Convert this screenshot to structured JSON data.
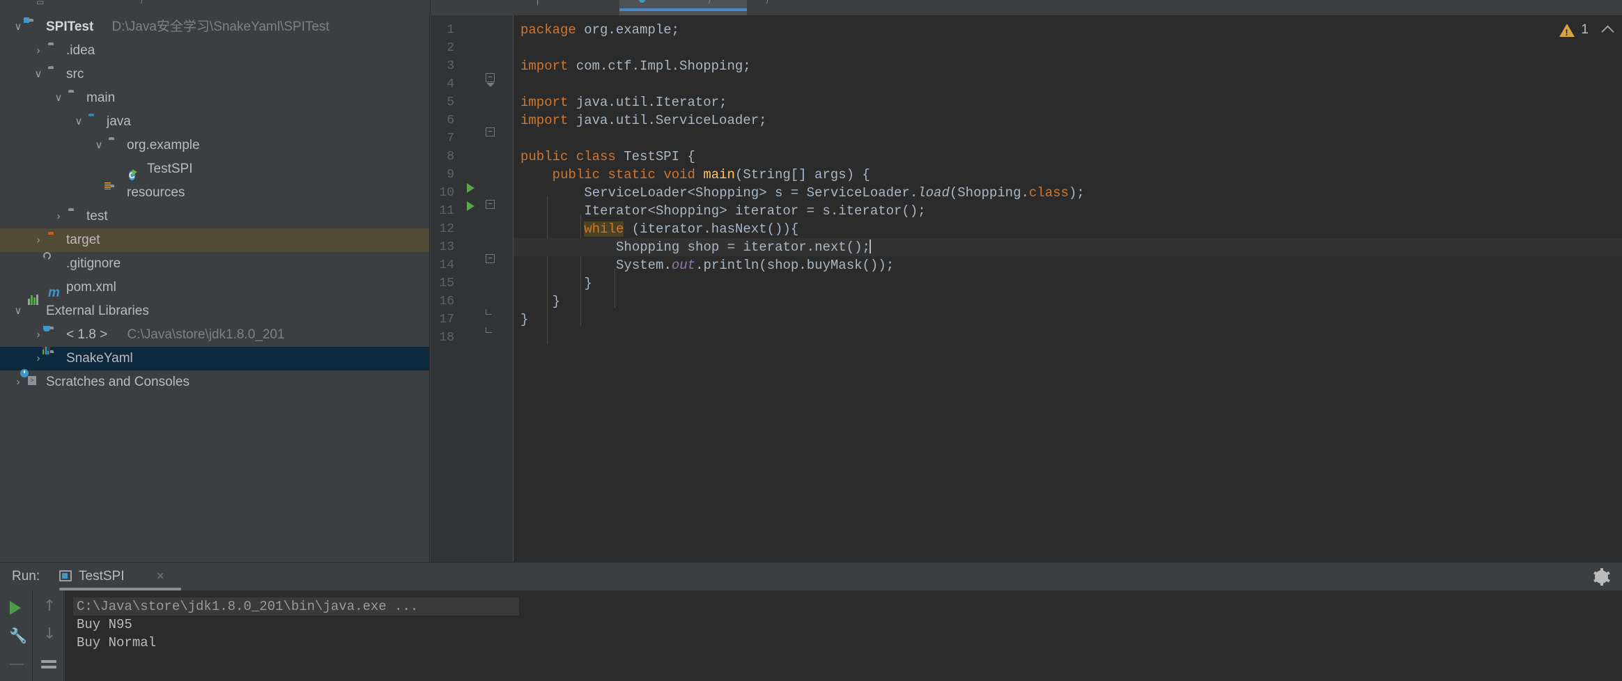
{
  "app": {
    "theme": "darcula",
    "accent": "#4a88c7",
    "warning_color": "#d9a343",
    "selection_blue": "#0d293e",
    "selection_amber": "#514b36"
  },
  "tab_bar": {
    "selected_tab_label": "",
    "selected_tab_icon": "java-class-icon"
  },
  "project_tree": {
    "items": [
      {
        "label": "SPITest",
        "sublabel": "D:\\Java安全学习\\SnakeYaml\\SPITest",
        "icon": "module-folder-icon",
        "twisty": "chevron-down",
        "depth": 0,
        "bold": true,
        "state": "normal"
      },
      {
        "label": ".idea",
        "sublabel": "",
        "icon": "folder-icon",
        "twisty": "chevron-right",
        "depth": 1,
        "bold": false,
        "state": "normal"
      },
      {
        "label": "src",
        "sublabel": "",
        "icon": "folder-icon",
        "twisty": "chevron-down",
        "depth": 1,
        "bold": false,
        "state": "normal"
      },
      {
        "label": "main",
        "sublabel": "",
        "icon": "folder-icon",
        "twisty": "chevron-down",
        "depth": 2,
        "bold": false,
        "state": "normal"
      },
      {
        "label": "java",
        "sublabel": "",
        "icon": "source-root-folder-icon",
        "twisty": "chevron-down",
        "depth": 3,
        "bold": false,
        "state": "normal"
      },
      {
        "label": "org.example",
        "sublabel": "",
        "icon": "package-icon",
        "twisty": "chevron-down",
        "depth": 4,
        "bold": false,
        "state": "normal"
      },
      {
        "label": "TestSPI",
        "sublabel": "",
        "icon": "java-class-runnable-icon",
        "twisty": "",
        "depth": 5,
        "bold": false,
        "state": "normal"
      },
      {
        "label": "resources",
        "sublabel": "",
        "icon": "resources-folder-icon",
        "twisty": "",
        "depth": 4,
        "bold": false,
        "state": "normal"
      },
      {
        "label": "test",
        "sublabel": "",
        "icon": "folder-icon",
        "twisty": "chevron-right",
        "depth": 2,
        "bold": false,
        "state": "normal"
      },
      {
        "label": "target",
        "sublabel": "",
        "icon": "excluded-folder-icon",
        "twisty": "chevron-right",
        "depth": 1,
        "bold": false,
        "state": "hover"
      },
      {
        "label": ".gitignore",
        "sublabel": "",
        "icon": "gitignore-file-icon",
        "twisty": "",
        "depth": 1,
        "bold": false,
        "state": "normal"
      },
      {
        "label": "pom.xml",
        "sublabel": "",
        "icon": "maven-icon",
        "twisty": "",
        "depth": 1,
        "bold": false,
        "state": "normal"
      },
      {
        "label": "External Libraries",
        "sublabel": "",
        "icon": "libraries-icon",
        "twisty": "chevron-down",
        "depth": 0,
        "bold": false,
        "state": "normal"
      },
      {
        "label": "< 1.8 >",
        "sublabel": "C:\\Java\\store\\jdk1.8.0_201",
        "icon": "jdk-folder-icon",
        "twisty": "chevron-right",
        "depth": 1,
        "bold": false,
        "state": "normal"
      },
      {
        "label": "SnakeYaml",
        "sublabel": "",
        "icon": "library-icon",
        "twisty": "chevron-right",
        "depth": 1,
        "bold": false,
        "state": "selected"
      },
      {
        "label": "Scratches and Consoles",
        "sublabel": "",
        "icon": "scratches-icon",
        "twisty": "chevron-right",
        "depth": 0,
        "bold": false,
        "state": "normal"
      }
    ]
  },
  "editor": {
    "warning_count": "1",
    "caret_line": 13,
    "line_numbers": [
      "1",
      "2",
      "3",
      "4",
      "5",
      "6",
      "7",
      "8",
      "9",
      "10",
      "11",
      "12",
      "13",
      "14",
      "15",
      "16",
      "17",
      "18"
    ],
    "lines": [
      {
        "n": 1,
        "text": "package org.example;"
      },
      {
        "n": 2,
        "text": ""
      },
      {
        "n": 3,
        "text": "import com.ctf.Impl.Shopping;"
      },
      {
        "n": 4,
        "text": ""
      },
      {
        "n": 5,
        "text": "import java.util.Iterator;"
      },
      {
        "n": 6,
        "text": "import java.util.ServiceLoader;"
      },
      {
        "n": 7,
        "text": ""
      },
      {
        "n": 8,
        "text": "public class TestSPI {"
      },
      {
        "n": 9,
        "text": "    public static void main(String[] args) {"
      },
      {
        "n": 10,
        "text": "        ServiceLoader<Shopping> s = ServiceLoader.load(Shopping.class);"
      },
      {
        "n": 11,
        "text": "        Iterator<Shopping> iterator = s.iterator();"
      },
      {
        "n": 12,
        "text": "        while (iterator.hasNext()){"
      },
      {
        "n": 13,
        "text": "            Shopping shop = iterator.next();"
      },
      {
        "n": 14,
        "text": "            System.out.println(shop.buyMask());"
      },
      {
        "n": 15,
        "text": "        }"
      },
      {
        "n": 16,
        "text": "    }"
      },
      {
        "n": 17,
        "text": "}"
      },
      {
        "n": 18,
        "text": ""
      }
    ]
  },
  "run_window": {
    "title": "Run:",
    "tab_label": "TestSPI",
    "close_label": "×",
    "settings_icon": "gear-icon",
    "rail_icons": [
      "rerun-icon",
      "wrench-icon",
      "up-arrow-icon",
      "down-arrow-icon",
      "soft-wrap-icon"
    ],
    "console_lines": [
      {
        "text": "C:\\Java\\store\\jdk1.8.0_201\\bin\\java.exe ...",
        "kind": "command"
      },
      {
        "text": "Buy N95",
        "kind": "stdout"
      },
      {
        "text": "Buy Normal",
        "kind": "stdout"
      }
    ]
  }
}
